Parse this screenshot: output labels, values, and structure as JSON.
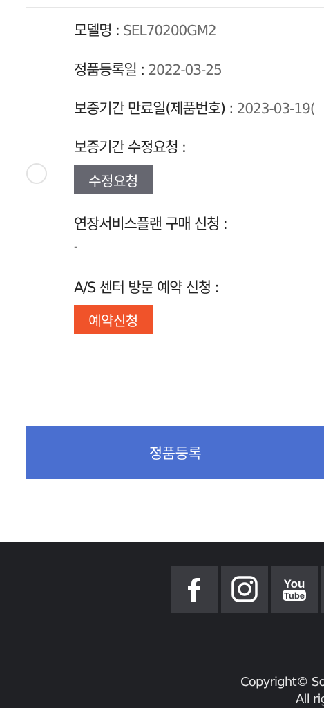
{
  "product_info": {
    "model_label": "모델명 : ",
    "model_value": "SEL70200GM2",
    "registration_date_label": "정품등록일 : ",
    "registration_date_value": "2022-03-25",
    "warranty_end_label": "보증기간 만료일(제품번호) : ",
    "warranty_end_value": "2023-03-19(",
    "warranty_edit_label": "보증기간 수정요청 :",
    "warranty_edit_button": "수정요청",
    "extended_service_label": "연장서비스플랜 구매 신청 :",
    "extended_service_value": "-",
    "as_center_label": "A/S 센터 방문 예약 신청 :",
    "reservation_button": "예약신청"
  },
  "actions": {
    "register_button": "정품등록"
  },
  "footer": {
    "social": [
      "facebook-icon",
      "instagram-icon",
      "youtube-icon"
    ],
    "youtube_text_top": "You",
    "youtube_text_bottom": "Tube",
    "copyright": "Copyright© So",
    "rights": "All rig"
  },
  "colors": {
    "primary": "#4a6fd0",
    "orange": "#f0532a",
    "gray_button": "#666770",
    "footer_bg": "#202125"
  }
}
